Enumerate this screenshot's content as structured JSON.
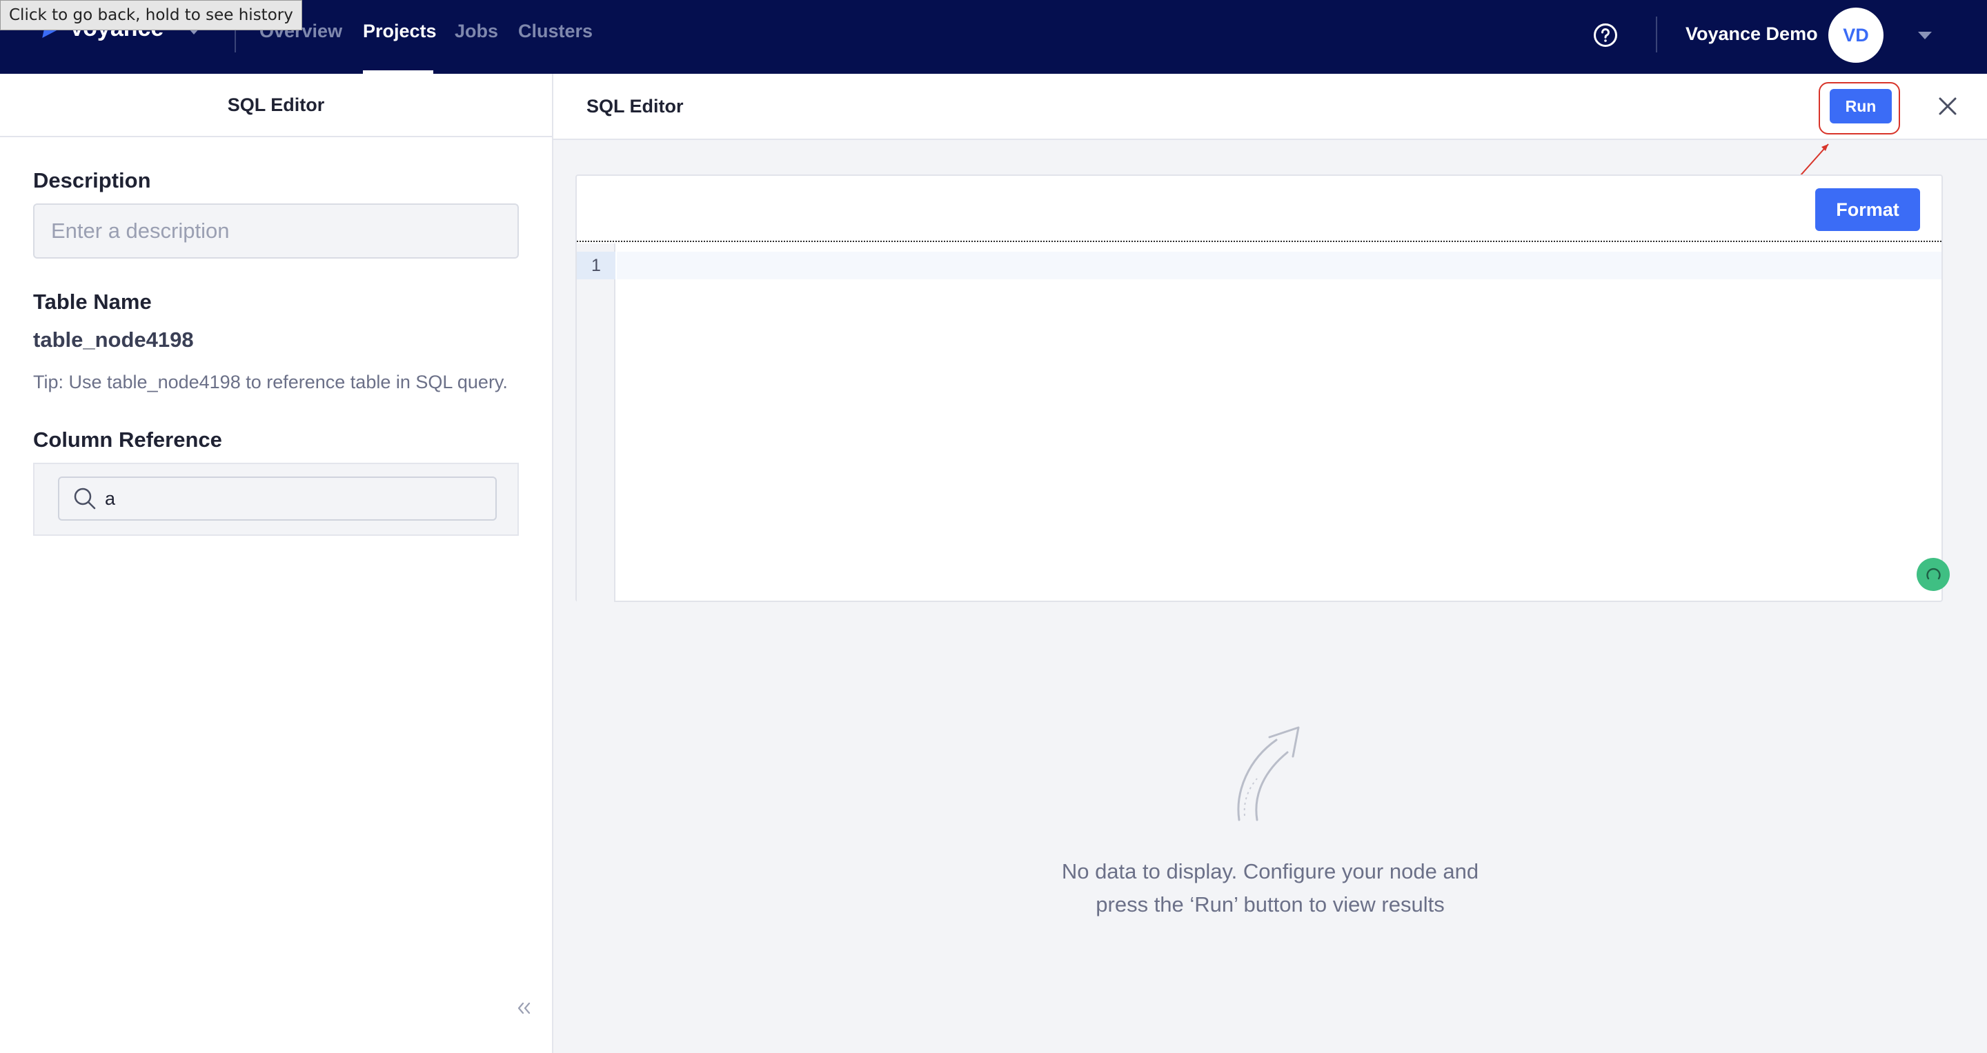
{
  "browser": {
    "back_tooltip": "Click to go back, hold to see history"
  },
  "topnav": {
    "brand": "Voyance",
    "links": [
      {
        "label": "Overview",
        "active": false
      },
      {
        "label": "Projects",
        "active": true
      },
      {
        "label": "Jobs",
        "active": false
      },
      {
        "label": "Clusters",
        "active": false
      }
    ],
    "user_name": "Voyance Demo",
    "avatar_initials": "VD",
    "colors": {
      "nav_bg": "#050f4f",
      "accent": "#3b6cf6"
    }
  },
  "left_panel": {
    "title": "SQL Editor",
    "description_label": "Description",
    "description_placeholder": "Enter a description",
    "description_value": "",
    "table_name_label": "Table Name",
    "table_name_value": "table_node4198",
    "tip": "Tip: Use table_node4198 to reference table in SQL query.",
    "column_ref_label": "Column Reference",
    "column_search_value": "a"
  },
  "right_panel": {
    "title": "SQL Editor",
    "run_label": "Run",
    "format_label": "Format",
    "line_numbers": [
      "1"
    ],
    "empty_line1": "No data to display. Configure your node and",
    "empty_line2": "press the ‘Run’ button to view results"
  }
}
